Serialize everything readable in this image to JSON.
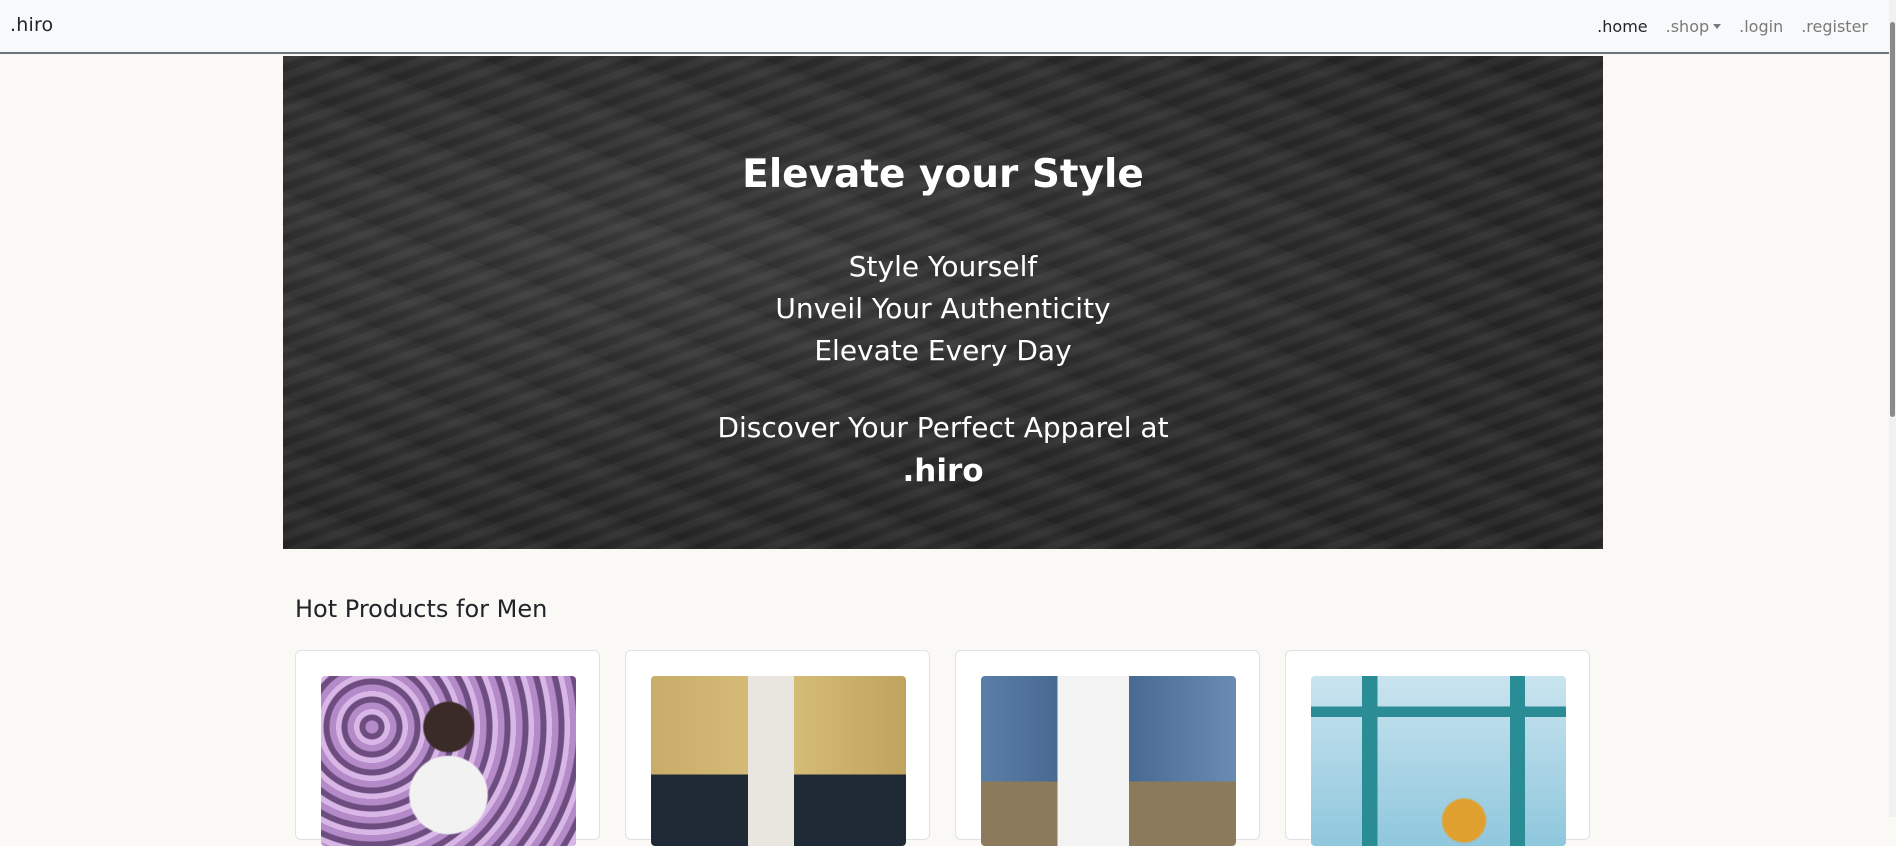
{
  "navbar": {
    "brand": ".hiro",
    "links": [
      {
        "label": ".home",
        "active": true
      },
      {
        "label": ".shop",
        "dropdown": true
      },
      {
        "label": ".login"
      },
      {
        "label": ".register"
      }
    ]
  },
  "hero": {
    "title": "Elevate your Style",
    "lines": [
      "Style Yourself",
      "Unveil Your Authenticity",
      "Elevate Every Day"
    ],
    "discover": "Discover Your Perfect Apparel at",
    "brand": ".hiro"
  },
  "products": {
    "section_title": "Hot Products for Men"
  },
  "colors": {
    "page_background": "#faf9f6",
    "navbar_background": "#f8f9fa",
    "hero_background": "#303030",
    "hero_text": "#ffffff"
  }
}
